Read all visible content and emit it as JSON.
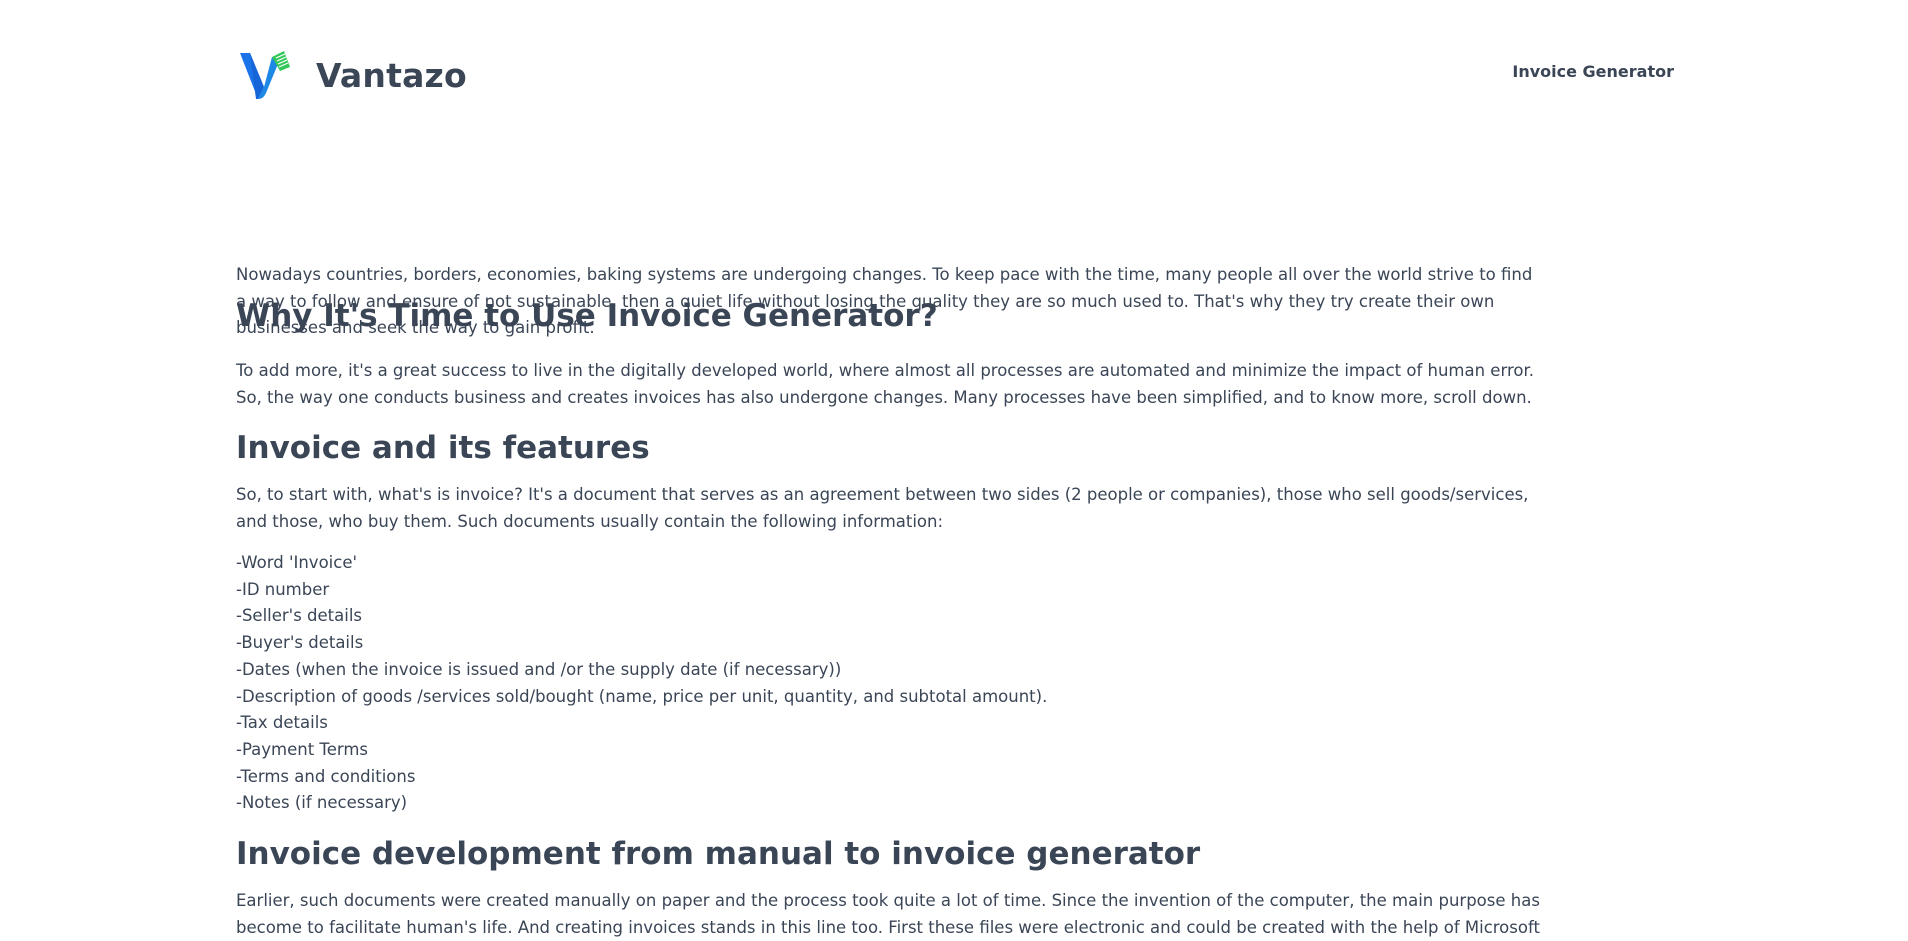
{
  "header": {
    "brand": "Vantazo",
    "logo_icon": "vantazo-logo-icon",
    "nav_link": "Invoice Generator",
    "colors": {
      "logo_blue": "#1a73e8",
      "logo_green": "#34c759",
      "text": "#3a4556"
    }
  },
  "article": {
    "intro_title": "Why It's Time to Use Invoice Generator?",
    "intro_paragraph": "Nowadays countries, borders, economies, baking systems are undergoing changes. To keep pace with the time, many people all over the world strive to find a way to follow and ensure of not sustainable, then a quiet life without losing the quality they are so much used to. That's why they try create their own businesses and seek the way to gain profit.",
    "second_paragraph": "To add more, it's a great success to live in the digitally developed world, where almost all processes are automated and minimize the impact of human error. So, the way one conducts business and creates invoices has also undergone changes. Many processes have been simplified, and to know more, scroll down.",
    "section1": {
      "title": "Invoice and its features",
      "paragraph": "So, to start with, what's is invoice? It's a document that serves as an agreement between two sides (2 people or companies), those who sell goods/services, and those, who buy them. Such documents usually contain the following information:",
      "items": [
        "-Word 'Invoice'",
        "-ID number",
        "-Seller's details",
        "-Buyer's details",
        "-Dates (when the invoice is issued and /or the supply date (if necessary))",
        "-Description of goods /services sold/bought (name, price per unit, quantity, and subtotal amount).",
        "-Tax details",
        "-Payment Terms",
        "-Terms and conditions",
        "-Notes (if necessary)"
      ]
    },
    "section2": {
      "title": "Invoice development from manual to invoice generator",
      "paragraph": "Earlier, such documents were created manually on paper and the process took quite a lot of time. Since the invention of the computer, the main purpose has become to facilitate human's life. And creating invoices stands in this line too. First these files were electronic and could be created with the help of Microsoft"
    }
  }
}
